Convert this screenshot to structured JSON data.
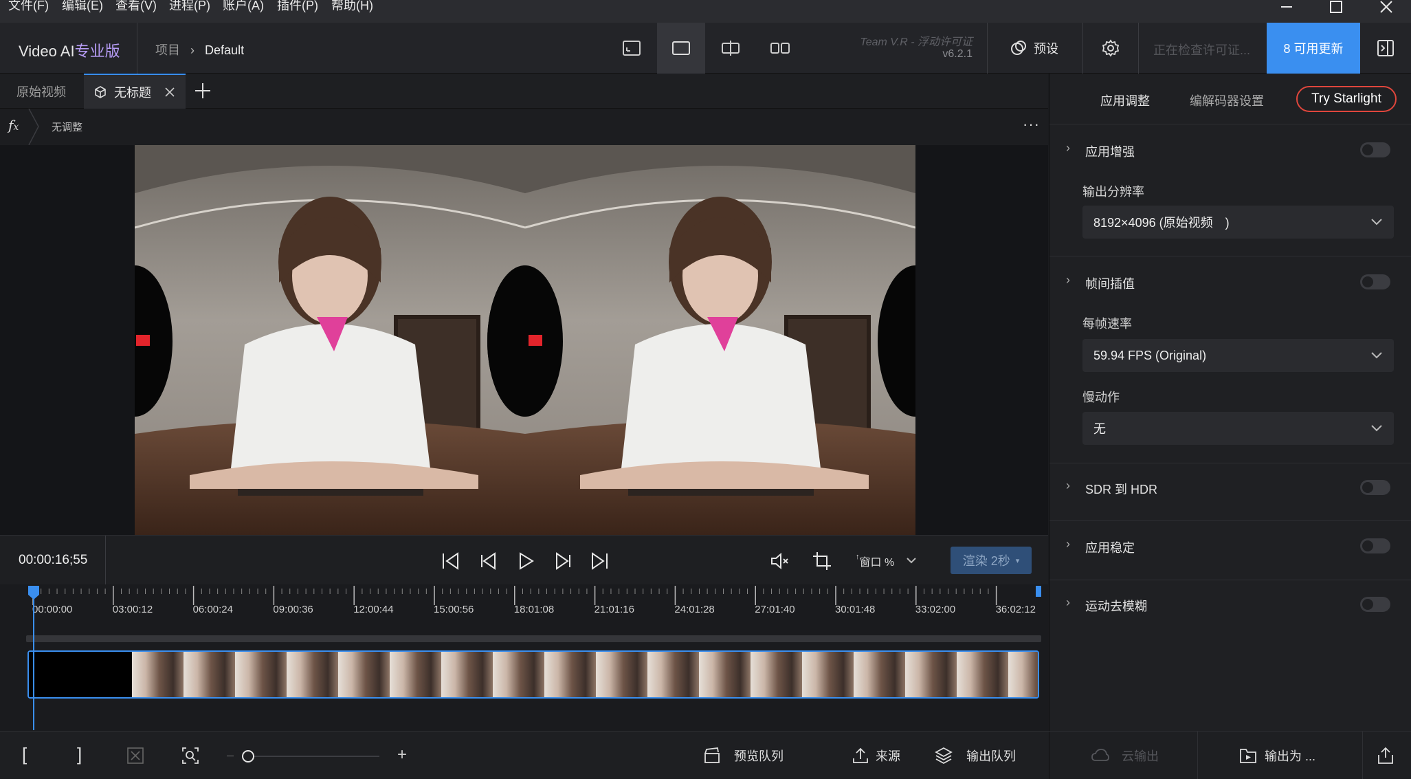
{
  "menu": {
    "items": [
      "文件(F)",
      "编辑(E)",
      "查看(V)",
      "进程(P)",
      "账户(A)",
      "插件(P)",
      "帮助(H)"
    ]
  },
  "title_bar": {
    "app_name": "Video AI",
    "app_edition": "专业版",
    "breadcrumb_project": "项目",
    "breadcrumb_current": "Default",
    "team_line": "Team V.R - 浮动许可证",
    "version": "v6.2.1",
    "presets_label": "预设",
    "license_status": "正在检查许可证...",
    "updates_label": "8 可用更新",
    "accent_color": "#3a8ff0"
  },
  "tabs": {
    "original_label": "原始视频",
    "active_label": "无标题",
    "adjust_label": "无调整"
  },
  "controls": {
    "timecode": "00:00:16;55",
    "zoom_label": "窗口 %",
    "render_label": "渲染 2秒"
  },
  "timeline": {
    "tick_labels": [
      "00:00:00",
      "03:00:12",
      "06:00:24",
      "09:00:36",
      "12:00:44",
      "15:00:56",
      "18:01:08",
      "21:01:16",
      "24:01:28",
      "27:01:40",
      "30:01:48",
      "33:02:00",
      "36:02:12"
    ]
  },
  "bottom": {
    "preview_queue": "预览队列",
    "source": "来源",
    "export_queue": "输出队列",
    "cloud_export": "云输出",
    "export_as": "输出为 ..."
  },
  "panel": {
    "tab_apply": "应用调整",
    "tab_codec": "编解码器设置",
    "try_button": "Try Starlight",
    "sections": {
      "enhance": "应用增强",
      "resolution_label": "输出分辨率",
      "resolution_value": "8192×4096 (原始视频　)",
      "interp": "帧间插值",
      "fps_label": "每帧速率",
      "fps_value": "59.94 FPS (Original)",
      "slowmo_label": "慢动作",
      "slowmo_value": "无",
      "sdr": "SDR 到 HDR",
      "stab": "应用稳定",
      "deblur": "运动去模糊"
    }
  },
  "icons": [
    "minimize-icon",
    "maximize-icon",
    "close-icon",
    "gear-icon",
    "presets-icon",
    "fx-icon",
    "cube-icon",
    "plus-icon",
    "more-icon",
    "skip-start-icon",
    "prev-frame-icon",
    "play-icon",
    "next-frame-icon",
    "skip-end-icon",
    "mute-icon",
    "crop-icon",
    "chevron-down-icon",
    "clapper-icon",
    "upload-icon",
    "layers-icon",
    "cloud-icon",
    "folder-play-icon",
    "share-icon",
    "panel-toggle-icon"
  ]
}
